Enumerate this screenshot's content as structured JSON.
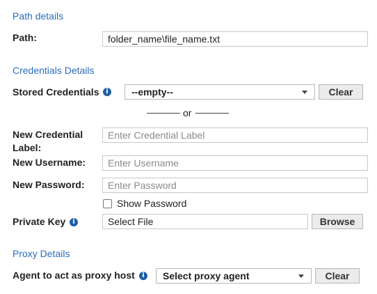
{
  "path_details": {
    "title": "Path details",
    "path_label": "Path:",
    "path_value": "folder_name\\file_name.txt"
  },
  "credentials_details": {
    "title": "Credentials Details",
    "stored_label": "Stored Credentials",
    "stored_value": "--empty--",
    "clear_label": "Clear",
    "or_text": "or",
    "new_label_label_line1": "New Credential",
    "new_label_label_line2": "Label:",
    "new_label_placeholder": "Enter Credential Label",
    "new_username_label": "New Username:",
    "new_username_placeholder": "Enter Username",
    "new_password_label": "New Password:",
    "new_password_placeholder": "Enter Password",
    "show_password_label": "Show Password",
    "show_password_checked": false,
    "private_key_label": "Private Key",
    "private_key_placeholder": "Select File",
    "browse_label": "Browse",
    "info_icon": "info-icon"
  },
  "proxy_details": {
    "title": "Proxy Details",
    "agent_label": "Agent to act as proxy host",
    "agent_value": "Select proxy agent",
    "clear_label": "Clear"
  }
}
